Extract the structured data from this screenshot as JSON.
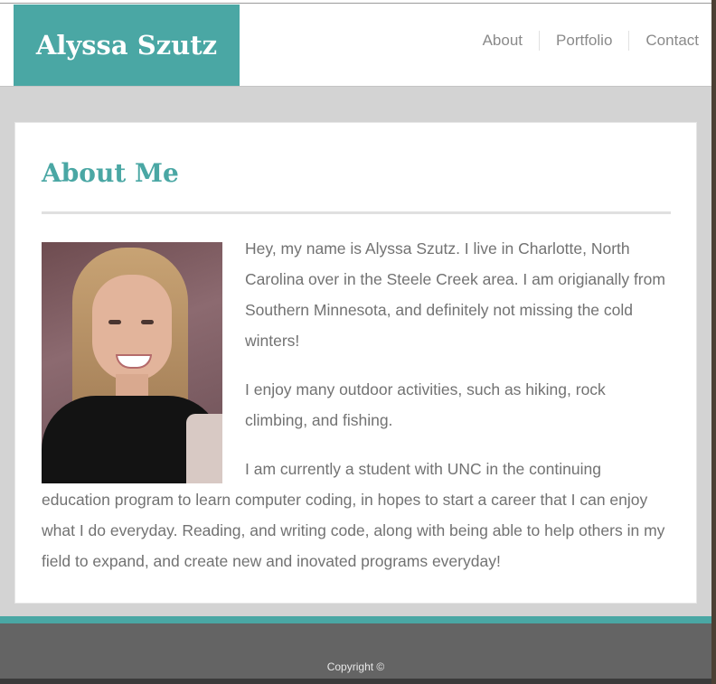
{
  "header": {
    "brand": "Alyssa Szutz",
    "nav": [
      "About",
      "Portfolio",
      "Contact"
    ]
  },
  "about": {
    "title": "About Me",
    "paragraphs": [
      "Hey, my name is Alyssa Szutz. I live in Charlotte, North Carolina over in the Steele Creek area. I am origianally from Southern Minnesota, and definitely not missing the cold winters!",
      "I enjoy many outdoor activities, such as hiking, rock climbing, and fishing.",
      "I am currently a student with UNC in the continuing education program to learn computer coding, in hopes to start a career that I can enjoy what I do everyday. Reading, and writing code, along with being able to help others in my field to expand, and create new and inovated programs everyday!"
    ]
  },
  "footer": {
    "copyright": "Copyright ©"
  },
  "colors": {
    "accent": "#4aa7a4",
    "background": "#d3d3d3",
    "footer": "#646464",
    "text": "#727272"
  }
}
